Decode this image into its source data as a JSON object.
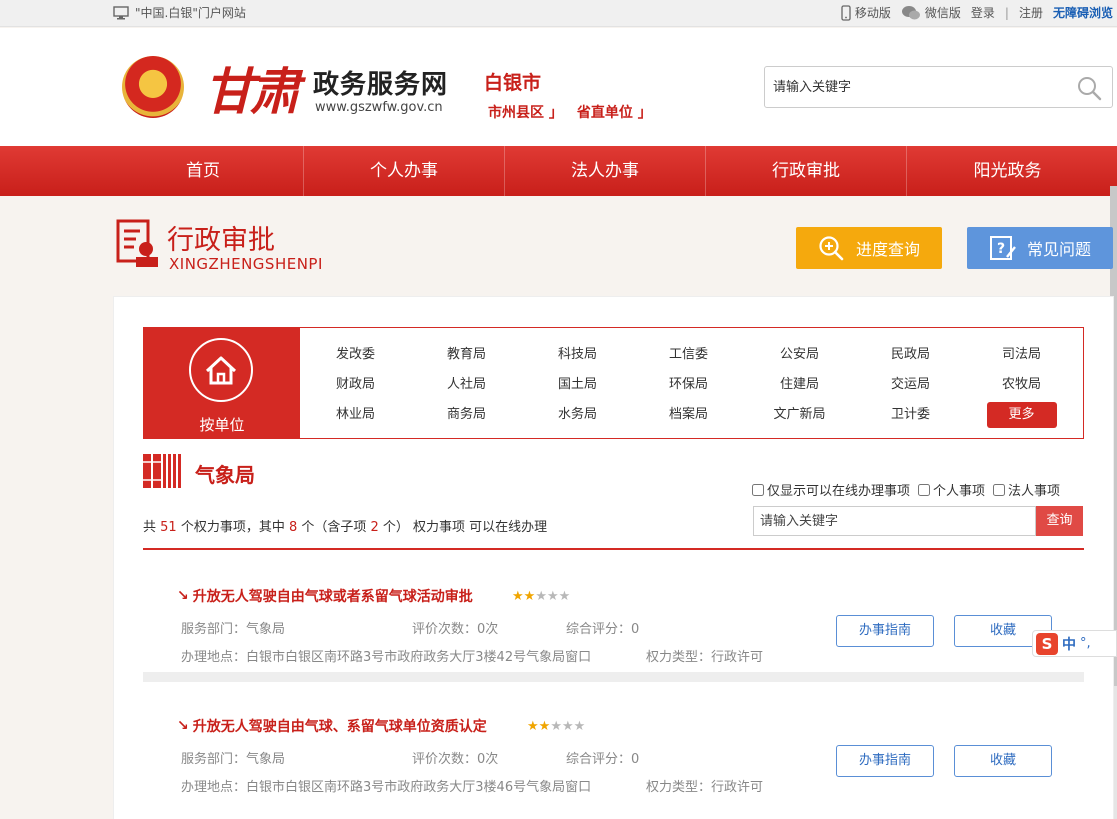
{
  "topbar": {
    "site_name": "\"中国.白银\"门户网站",
    "mobile": "移动版",
    "wechat": "微信版",
    "login": "登录",
    "sep": "|",
    "register": "注册",
    "accessible": "无障碍浏览"
  },
  "header": {
    "logo_cn": "甘肃",
    "logo_title": "政务服务网",
    "logo_url": "www.gszwfw.gov.cn",
    "city": "白银市",
    "city_links": [
      "市州县区 」",
      "省直单位 」"
    ],
    "search_placeholder": "请输入关键字"
  },
  "nav": [
    "首页",
    "个人办事",
    "法人办事",
    "行政审批",
    "阳光政务"
  ],
  "section": {
    "title": "行政审批",
    "subtitle": "XINGZHENGSHENPI",
    "progress_btn": "进度查询",
    "faq_btn": "常见问题"
  },
  "unit_filter": {
    "tab_label": "按单位",
    "rows": [
      [
        "发改委",
        "教育局",
        "科技局",
        "工信委",
        "公安局",
        "民政局",
        "司法局"
      ],
      [
        "财政局",
        "人社局",
        "国土局",
        "环保局",
        "住建局",
        "交运局",
        "农牧局"
      ],
      [
        "林业局",
        "商务局",
        "水务局",
        "档案局",
        "文广新局",
        "卫计委"
      ]
    ],
    "more": "更多"
  },
  "bureau": {
    "title": "气象局",
    "filters": [
      "仅显示可以在线办理事项",
      "个人事项",
      "法人事项"
    ],
    "summary": {
      "p1": "共 ",
      "total": "51",
      "p2": " 个权力事项，其中 ",
      "online": "8",
      "p3": " 个（含子项 ",
      "sub": "2",
      "p4": " 个） 权力事项 可以在线办理"
    },
    "search_placeholder": "请输入关键字",
    "query_btn": "查询"
  },
  "items": [
    {
      "title": "升放无人驾驶自由气球或者系留气球活动审批",
      "stars": 2,
      "dept": "服务部门：气象局",
      "reviews": "评价次数：0次",
      "score": "综合评分：0",
      "location": "办理地点：白银市白银区南环路3号市政府政务大厅3楼42号气象局窗口",
      "power_type": "权力类型：行政许可",
      "guide_btn": "办事指南",
      "fav_btn": "收藏"
    },
    {
      "title": "升放无人驾驶自由气球、系留气球单位资质认定",
      "stars": 2,
      "dept": "服务部门：气象局",
      "reviews": "评价次数：0次",
      "score": "综合评分：0",
      "location": "办理地点：白银市白银区南环路3号市政府政务大厅3楼46号气象局窗口",
      "power_type": "权力类型：行政许可",
      "guide_btn": "办事指南",
      "fav_btn": "收藏"
    }
  ],
  "ime": {
    "logo": "S",
    "mode": "中",
    "punct": "°,"
  },
  "colors": {
    "brand_red": "#c8201a",
    "progress_orange": "#f5a90d",
    "faq_blue": "#5e95dc",
    "star_on": "#f0a500"
  }
}
